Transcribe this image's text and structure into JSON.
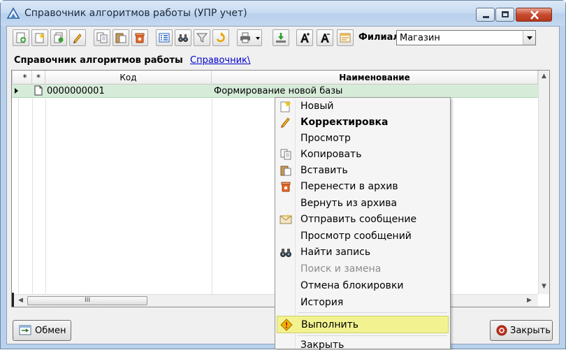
{
  "window": {
    "title": "Справочник алгоритмов работы (УПР учет)"
  },
  "toolbar": {
    "filial_label": "Филиал",
    "filial_value": "Магазин",
    "buttons": [
      {
        "icon": "add-icon"
      },
      {
        "icon": "new-star-icon"
      },
      {
        "icon": "add-copy-icon"
      },
      {
        "icon": "edit-pencil-icon"
      },
      {
        "icon": "copy-icon"
      },
      {
        "icon": "paste-icon"
      },
      {
        "icon": "archive-icon"
      },
      {
        "icon": "list-view-icon"
      },
      {
        "icon": "binoculars-icon"
      },
      {
        "icon": "filter-icon"
      },
      {
        "icon": "refresh-arrow-icon"
      },
      {
        "icon": "print-icon"
      },
      {
        "icon": "export-icon"
      },
      {
        "icon": "font-increase-icon"
      },
      {
        "icon": "font-decrease-icon"
      },
      {
        "icon": "settings-card-icon"
      }
    ]
  },
  "heading": {
    "title": "Справочник алгоритмов работы",
    "link": "Справочник\\"
  },
  "grid": {
    "columns": [
      "*",
      "*",
      "Код",
      "Наименование"
    ],
    "rows": [
      {
        "code": "0000000001",
        "name": "Формирование новой базы"
      }
    ],
    "hscroll_thumb": "III"
  },
  "context_menu": {
    "items": [
      {
        "label": "Новый",
        "icon": "new-star-icon",
        "style": "normal"
      },
      {
        "label": "Корректировка",
        "icon": "edit-pencil-icon",
        "style": "bold"
      },
      {
        "label": "Просмотр",
        "icon": "",
        "style": "normal"
      },
      {
        "label": "Копировать",
        "icon": "copy-icon",
        "style": "normal"
      },
      {
        "label": "Вставить",
        "icon": "paste-icon",
        "style": "normal"
      },
      {
        "label": "Перенести в архив",
        "icon": "archive-icon",
        "style": "normal"
      },
      {
        "label": "Вернуть из архива",
        "icon": "",
        "style": "normal"
      },
      {
        "label": "Отправить сообщение",
        "icon": "message-icon",
        "style": "normal"
      },
      {
        "label": "Просмотр сообщений",
        "icon": "",
        "style": "normal"
      },
      {
        "label": "Найти запись",
        "icon": "binoculars-icon",
        "style": "normal"
      },
      {
        "label": "Поиск и замена",
        "icon": "",
        "style": "disabled"
      },
      {
        "label": "Отмена блокировки",
        "icon": "",
        "style": "normal"
      },
      {
        "label": "История",
        "icon": "",
        "style": "normal"
      },
      {
        "label": "Выполнить",
        "icon": "warning-run-icon",
        "style": "highlighted"
      },
      {
        "label": "Закрыть",
        "icon": "",
        "style": "normal"
      }
    ]
  },
  "footer": {
    "exchange_label": "Обмен",
    "close_label": "Закрыть"
  },
  "colors": {
    "selected_row": "#d6ecd9",
    "menu_highlight": "#f3f290",
    "link": "#0000cc"
  }
}
